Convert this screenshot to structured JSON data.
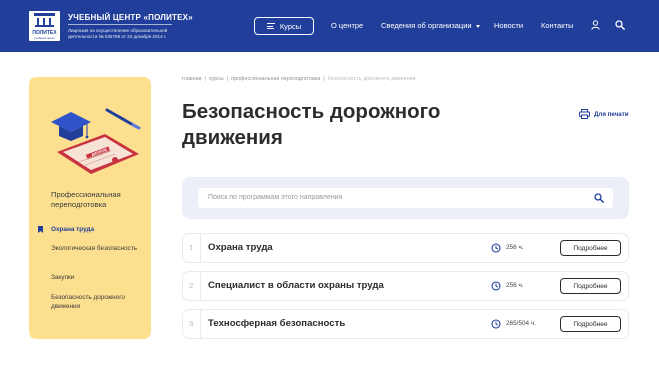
{
  "header": {
    "logo_word": "ПОЛИТЕХ",
    "logo_sub": "учебный центр",
    "title": "УЧЕБНЫЙ ЦЕНТР «ПОЛИТЕХ»",
    "license": "Лицензия на осуществление образовательной деятельности № 035768 от 23 декабря 2014 г.",
    "courses_label": "Курсы",
    "nav": {
      "about": "О центре",
      "org_info": "Сведения об организации",
      "news": "Новости",
      "contacts": "Контакты"
    }
  },
  "sidebar": {
    "category": "Профессиональная переподготовка",
    "illustration_text": "ДИПЛОМ",
    "items": [
      {
        "label": "Охрана труда",
        "active": true
      },
      {
        "label": "Экологическая безопасность",
        "active": false
      },
      {
        "label": "Закупки",
        "active": false
      },
      {
        "label": "Безопасность дорожного движения",
        "active": false
      }
    ]
  },
  "breadcrumb": [
    "главная",
    "курсы",
    "профессиональная переподготовка",
    "безопасность дорожного движения"
  ],
  "page_title": "Безопасность дорожного движения",
  "print_label": "Для печати",
  "search": {
    "placeholder": "Поиск по программам этого направления"
  },
  "courses": [
    {
      "num": "1",
      "name": "Охрана труда",
      "hours": "256 ч.",
      "button": "Подробнее"
    },
    {
      "num": "2",
      "name": "Специалист в области охраны труда",
      "hours": "256 ч.",
      "button": "Подробнее"
    },
    {
      "num": "3",
      "name": "Техносферная безопасность",
      "hours": "265/504 ч.",
      "button": "Подробнее"
    }
  ],
  "colors": {
    "header_bg": "#213f9a",
    "sidebar_bg": "#fde08f",
    "accent": "#213f9a",
    "search_panel_bg": "#eceef8"
  }
}
